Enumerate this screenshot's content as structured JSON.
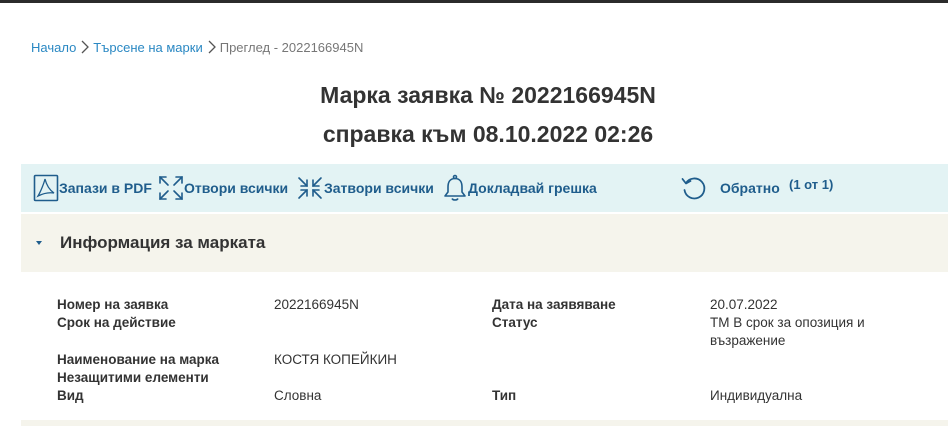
{
  "breadcrumb": {
    "home": "Начало",
    "search": "Търсене на марки",
    "current": "Преглед - 2022166945N"
  },
  "title": {
    "line1": "Марка заявка № 2022166945N",
    "line2": "справка към 08.10.2022 02:26"
  },
  "toolbar": {
    "save_pdf": "Запази в PDF",
    "open_all": "Отвори всички",
    "close_all": "Затвори всички",
    "report_error": "Докладвай грешка",
    "back": "Обратно",
    "counter": "(1 от 1)"
  },
  "section": {
    "title": "Информация за марката"
  },
  "fields": {
    "app_number": {
      "label": "Номер на заявка",
      "value": "2022166945N"
    },
    "filing_date": {
      "label": "Дата на заявяване",
      "value": "20.07.2022"
    },
    "validity": {
      "label": "Срок на действие",
      "value": ""
    },
    "status": {
      "label": "Статус",
      "value_line1": "ТМ В срок за опозиция и",
      "value_line2": "възражение"
    },
    "mark_name": {
      "label": "Наименование на марка",
      "value": "КОСТЯ КОПЕЙКИН"
    },
    "unprotected": {
      "label": "Незащитими елементи",
      "value": ""
    },
    "kind": {
      "label": "Вид",
      "value": "Словна"
    },
    "type": {
      "label": "Тип",
      "value": "Индивидуална"
    }
  },
  "colors": {
    "link": "#2a88c3",
    "toolbar_bg": "#e3f3f4",
    "toolbar_text": "#1f5d8c",
    "section_bg": "#f5f4ec"
  },
  "icons": {
    "breadcrumb_separator": "chevron-right-icon",
    "save_pdf": "pdf-icon",
    "open_all": "expand-icon",
    "close_all": "collapse-icon",
    "report_error": "bell-icon",
    "back": "undo-icon",
    "section_toggle": "caret-down-icon"
  }
}
